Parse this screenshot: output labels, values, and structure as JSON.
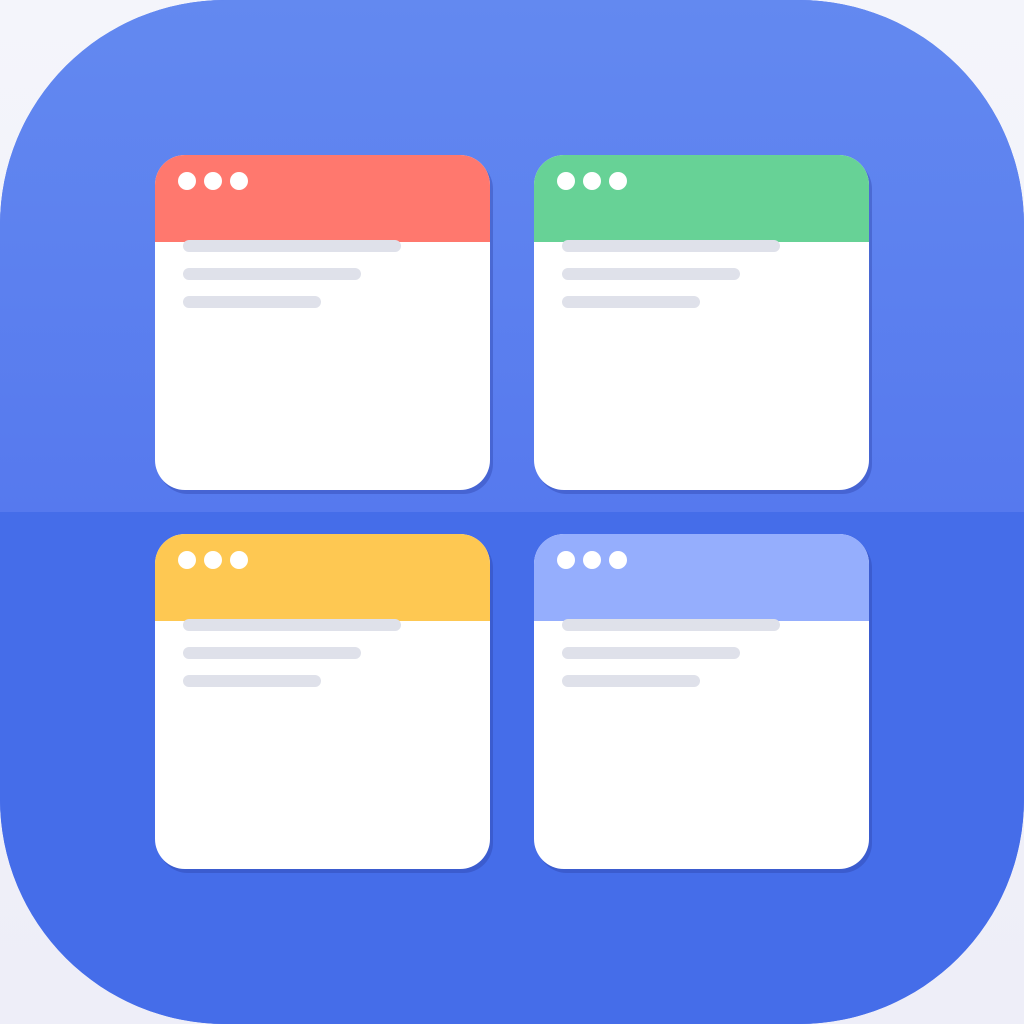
{
  "app_icon": {
    "colors": {
      "background_top": "#6389f0",
      "background_bottom": "#456de9",
      "window_body": "#ffffff",
      "placeholder_line": "#dfe1ea",
      "dot": "#ffffff"
    },
    "windows": [
      {
        "titlebar_color": "#ff786e",
        "dots": 3,
        "placeholder_lines": 3
      },
      {
        "titlebar_color": "#67d296",
        "dots": 3,
        "placeholder_lines": 3
      },
      {
        "titlebar_color": "#fec852",
        "dots": 3,
        "placeholder_lines": 3
      },
      {
        "titlebar_color": "#95aefd",
        "dots": 3,
        "placeholder_lines": 3
      }
    ]
  }
}
